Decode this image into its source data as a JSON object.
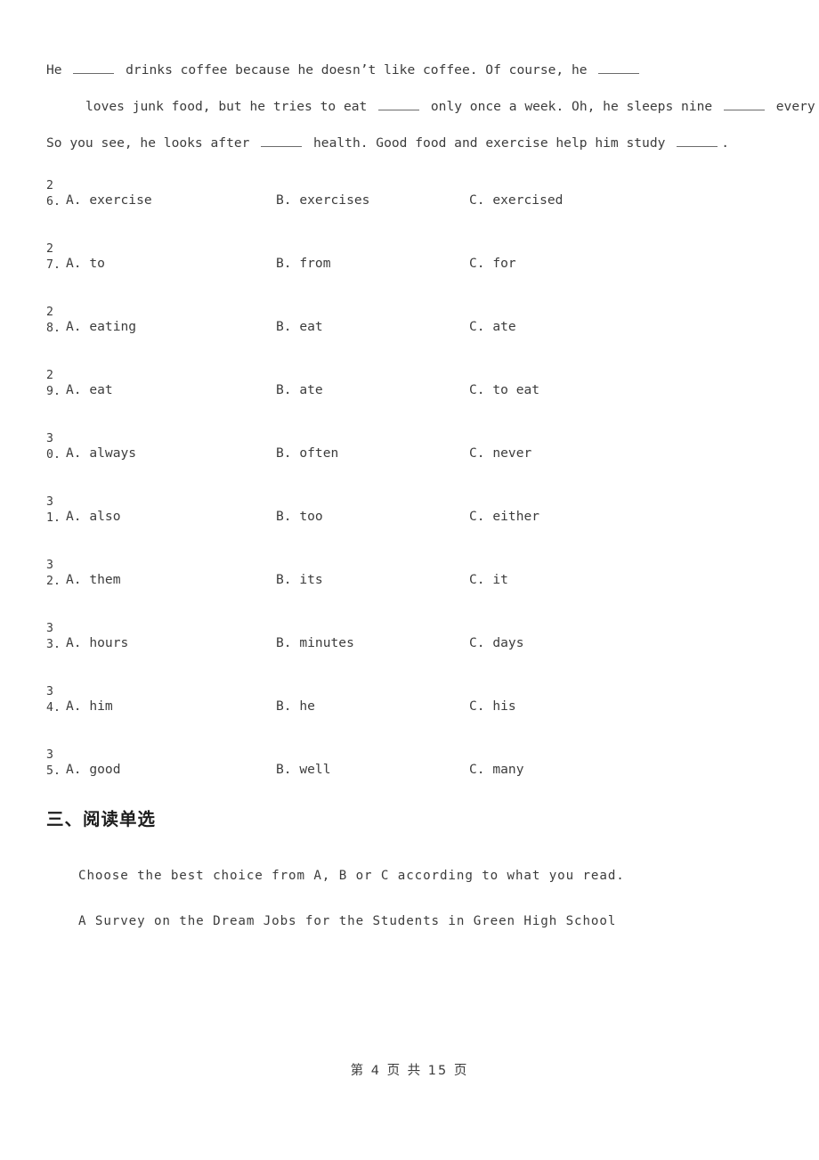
{
  "passage": {
    "lines": [
      {
        "indent": false,
        "segments": [
          {
            "type": "text",
            "text": "He "
          },
          {
            "type": "blank"
          },
          {
            "type": "text",
            "text": " drinks coffee because he doesn’t like coffee. Of course, he "
          },
          {
            "type": "blank"
          }
        ]
      },
      {
        "indent": true,
        "segments": [
          {
            "type": "text",
            "text": "loves junk food, but he tries to eat "
          },
          {
            "type": "blank"
          },
          {
            "type": "text",
            "text": " only once a week. Oh, he sleeps nine "
          },
          {
            "type": "blank"
          },
          {
            "type": "text",
            "text": " every night."
          }
        ]
      },
      {
        "indent": false,
        "segments": [
          {
            "type": "text",
            "text": "So you see, he looks after "
          },
          {
            "type": "blank"
          },
          {
            "type": "text",
            "text": " health. Good food and exercise help him study "
          },
          {
            "type": "blank"
          },
          {
            "type": "text",
            "text": "."
          }
        ]
      }
    ]
  },
  "questions": [
    {
      "number": "26.",
      "a": "A. exercise",
      "b": "B. exercises",
      "c": "C. exercised"
    },
    {
      "number": "27.",
      "a": "A. to",
      "b": "B. from",
      "c": "C. for"
    },
    {
      "number": "28.",
      "a": "A. eating",
      "b": "B. eat",
      "c": "C. ate"
    },
    {
      "number": "29.",
      "a": "A. eat",
      "b": "B. ate",
      "c": "C. to eat"
    },
    {
      "number": "30.",
      "a": "A. always",
      "b": "B. often",
      "c": "C. never"
    },
    {
      "number": "31.",
      "a": "A. also",
      "b": "B. too",
      "c": "C. either"
    },
    {
      "number": "32.",
      "a": "A. them",
      "b": "B. its",
      "c": "C. it"
    },
    {
      "number": "33.",
      "a": "A. hours",
      "b": "B. minutes",
      "c": "C. days"
    },
    {
      "number": "34.",
      "a": "A. him",
      "b": "B. he",
      "c": "C. his"
    },
    {
      "number": "35.",
      "a": "A. good",
      "b": "B. well",
      "c": "C. many"
    }
  ],
  "section": {
    "heading": "三、阅读单选"
  },
  "reading": {
    "instruction": "Choose the best choice from A, B or C according to what you read.",
    "title": "A Survey on the Dream Jobs for the Students in Green High School"
  },
  "footer": {
    "text": "第 4 页 共 15 页"
  },
  "colors": {
    "text": "#3c3c3c",
    "heading": "#1d1d1d",
    "rule": "#6b6b6b",
    "background": "#ffffff"
  }
}
